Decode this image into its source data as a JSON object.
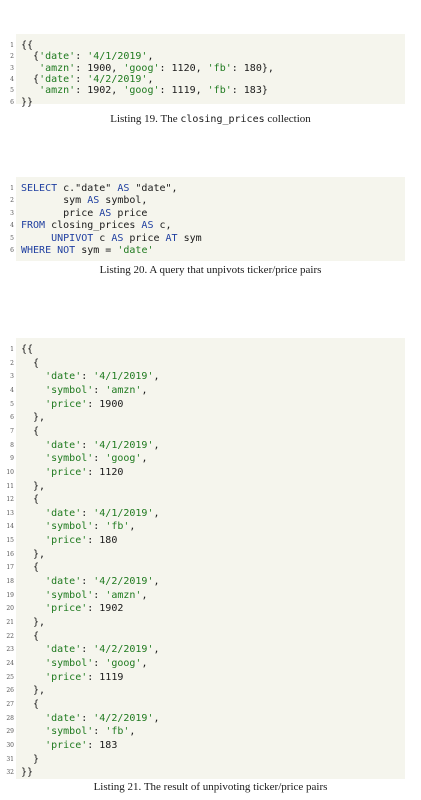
{
  "listings": [
    {
      "caption_prefix": "Listing 19.",
      "caption_parts": [
        "The ",
        "closing_prices",
        " collection"
      ],
      "lines": [
        "{{",
        "  {'date': '4/1/2019',",
        "   'amzn': 1900, 'goog': 1120, 'fb': 180},",
        "  {'date': '4/2/2019',",
        "   'amzn': 1902, 'goog': 1119, 'fb': 183}",
        "}}"
      ]
    },
    {
      "caption_prefix": "Listing 20.",
      "caption_parts": [
        "A query that unpivots ticker/price pairs"
      ],
      "lines": [
        "SELECT c.\"date\" AS \"date\",",
        "       sym AS symbol,",
        "       price AS price",
        "FROM closing_prices AS c,",
        "     UNPIVOT c AS price AT sym",
        "WHERE NOT sym = 'date'"
      ]
    },
    {
      "caption_prefix": "Listing 21.",
      "caption_parts": [
        "The result of unpivoting ticker/price pairs"
      ],
      "lines": [
        "{{",
        "  {",
        "    'date': '4/1/2019',",
        "    'symbol': 'amzn',",
        "    'price': 1900",
        "  },",
        "  {",
        "    'date': '4/1/2019',",
        "    'symbol': 'goog',",
        "    'price': 1120",
        "  },",
        "  {",
        "    'date': '4/1/2019',",
        "    'symbol': 'fb',",
        "    'price': 180",
        "  },",
        "  {",
        "    'date': '4/2/2019',",
        "    'symbol': 'amzn',",
        "    'price': 1902",
        "  },",
        "  {",
        "    'date': '4/2/2019',",
        "    'symbol': 'goog',",
        "    'price': 1119",
        "  },",
        "  {",
        "    'date': '4/2/2019',",
        "    'symbol': 'fb',",
        "    'price': 183",
        "  }",
        "}}"
      ]
    }
  ]
}
